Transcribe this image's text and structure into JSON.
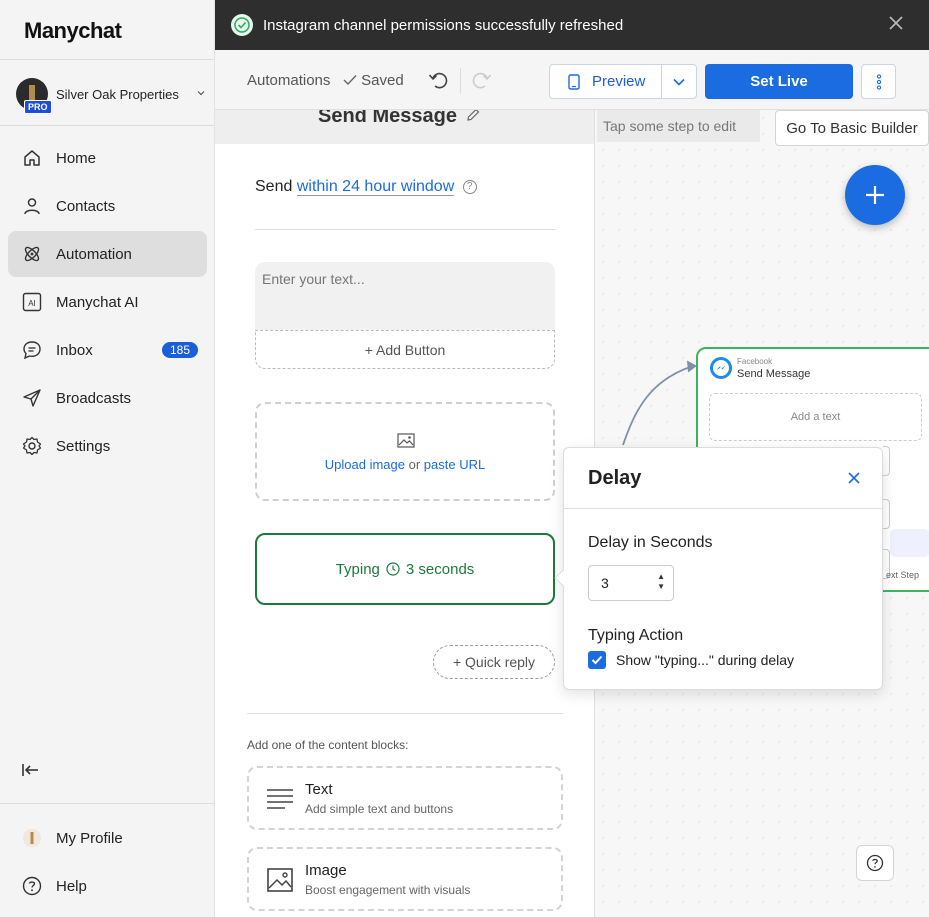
{
  "brand": {
    "logo": "Manychat",
    "accent": "#1a6ce0"
  },
  "account": {
    "name": "Silver Oak Properties",
    "plan_badge": "PRO"
  },
  "sidebar": {
    "items": [
      {
        "label": "Home",
        "icon": "home-icon"
      },
      {
        "label": "Contacts",
        "icon": "person-icon"
      },
      {
        "label": "Automation",
        "icon": "atom-icon",
        "active": true
      },
      {
        "label": "Manychat AI",
        "icon": "ai-icon"
      },
      {
        "label": "Inbox",
        "icon": "chat-bubble-icon",
        "badge": "185"
      },
      {
        "label": "Broadcasts",
        "icon": "send-icon"
      },
      {
        "label": "Settings",
        "icon": "gear-icon"
      }
    ],
    "bottom": [
      {
        "label": "My Profile",
        "icon": "profile-avatar-icon"
      },
      {
        "label": "Help",
        "icon": "help-circle-icon"
      }
    ]
  },
  "toast": {
    "message": "Instagram channel permissions successfully refreshed",
    "status_color": "#27ae60"
  },
  "toolbar": {
    "breadcrumb": "Automations",
    "saved": "Saved",
    "preview": "Preview",
    "set_live": "Set Live"
  },
  "editor": {
    "title": "Send Message",
    "send_prefix": "Send",
    "send_window": "within 24 hour window",
    "text_placeholder": "Enter your text...",
    "add_button": "+ Add Button",
    "upload_image": "Upload image",
    "upload_or": "or",
    "paste_url": "paste URL",
    "typing_label": "Typing",
    "typing_duration": "3 seconds",
    "quick_reply": "+ Quick reply",
    "blocks_label": "Add one of the content blocks:",
    "blocks": [
      {
        "title": "Text",
        "subtitle": "Add simple text and buttons",
        "icon": "text-lines-icon"
      },
      {
        "title": "Image",
        "subtitle": "Boost engagement with visuals",
        "icon": "image-icon"
      }
    ]
  },
  "canvas": {
    "hint": "Tap some step to edit",
    "basic_builder": "Go To Basic Builder",
    "node": {
      "source": "Facebook",
      "title": "Send Message",
      "add_text": "Add a text",
      "next_step": "ext Step"
    }
  },
  "delay_popup": {
    "title": "Delay",
    "seconds_label": "Delay in Seconds",
    "seconds_value": "3",
    "typing_action_label": "Typing Action",
    "checkbox_label": "Show \"typing...\" during delay",
    "checkbox_checked": true
  }
}
